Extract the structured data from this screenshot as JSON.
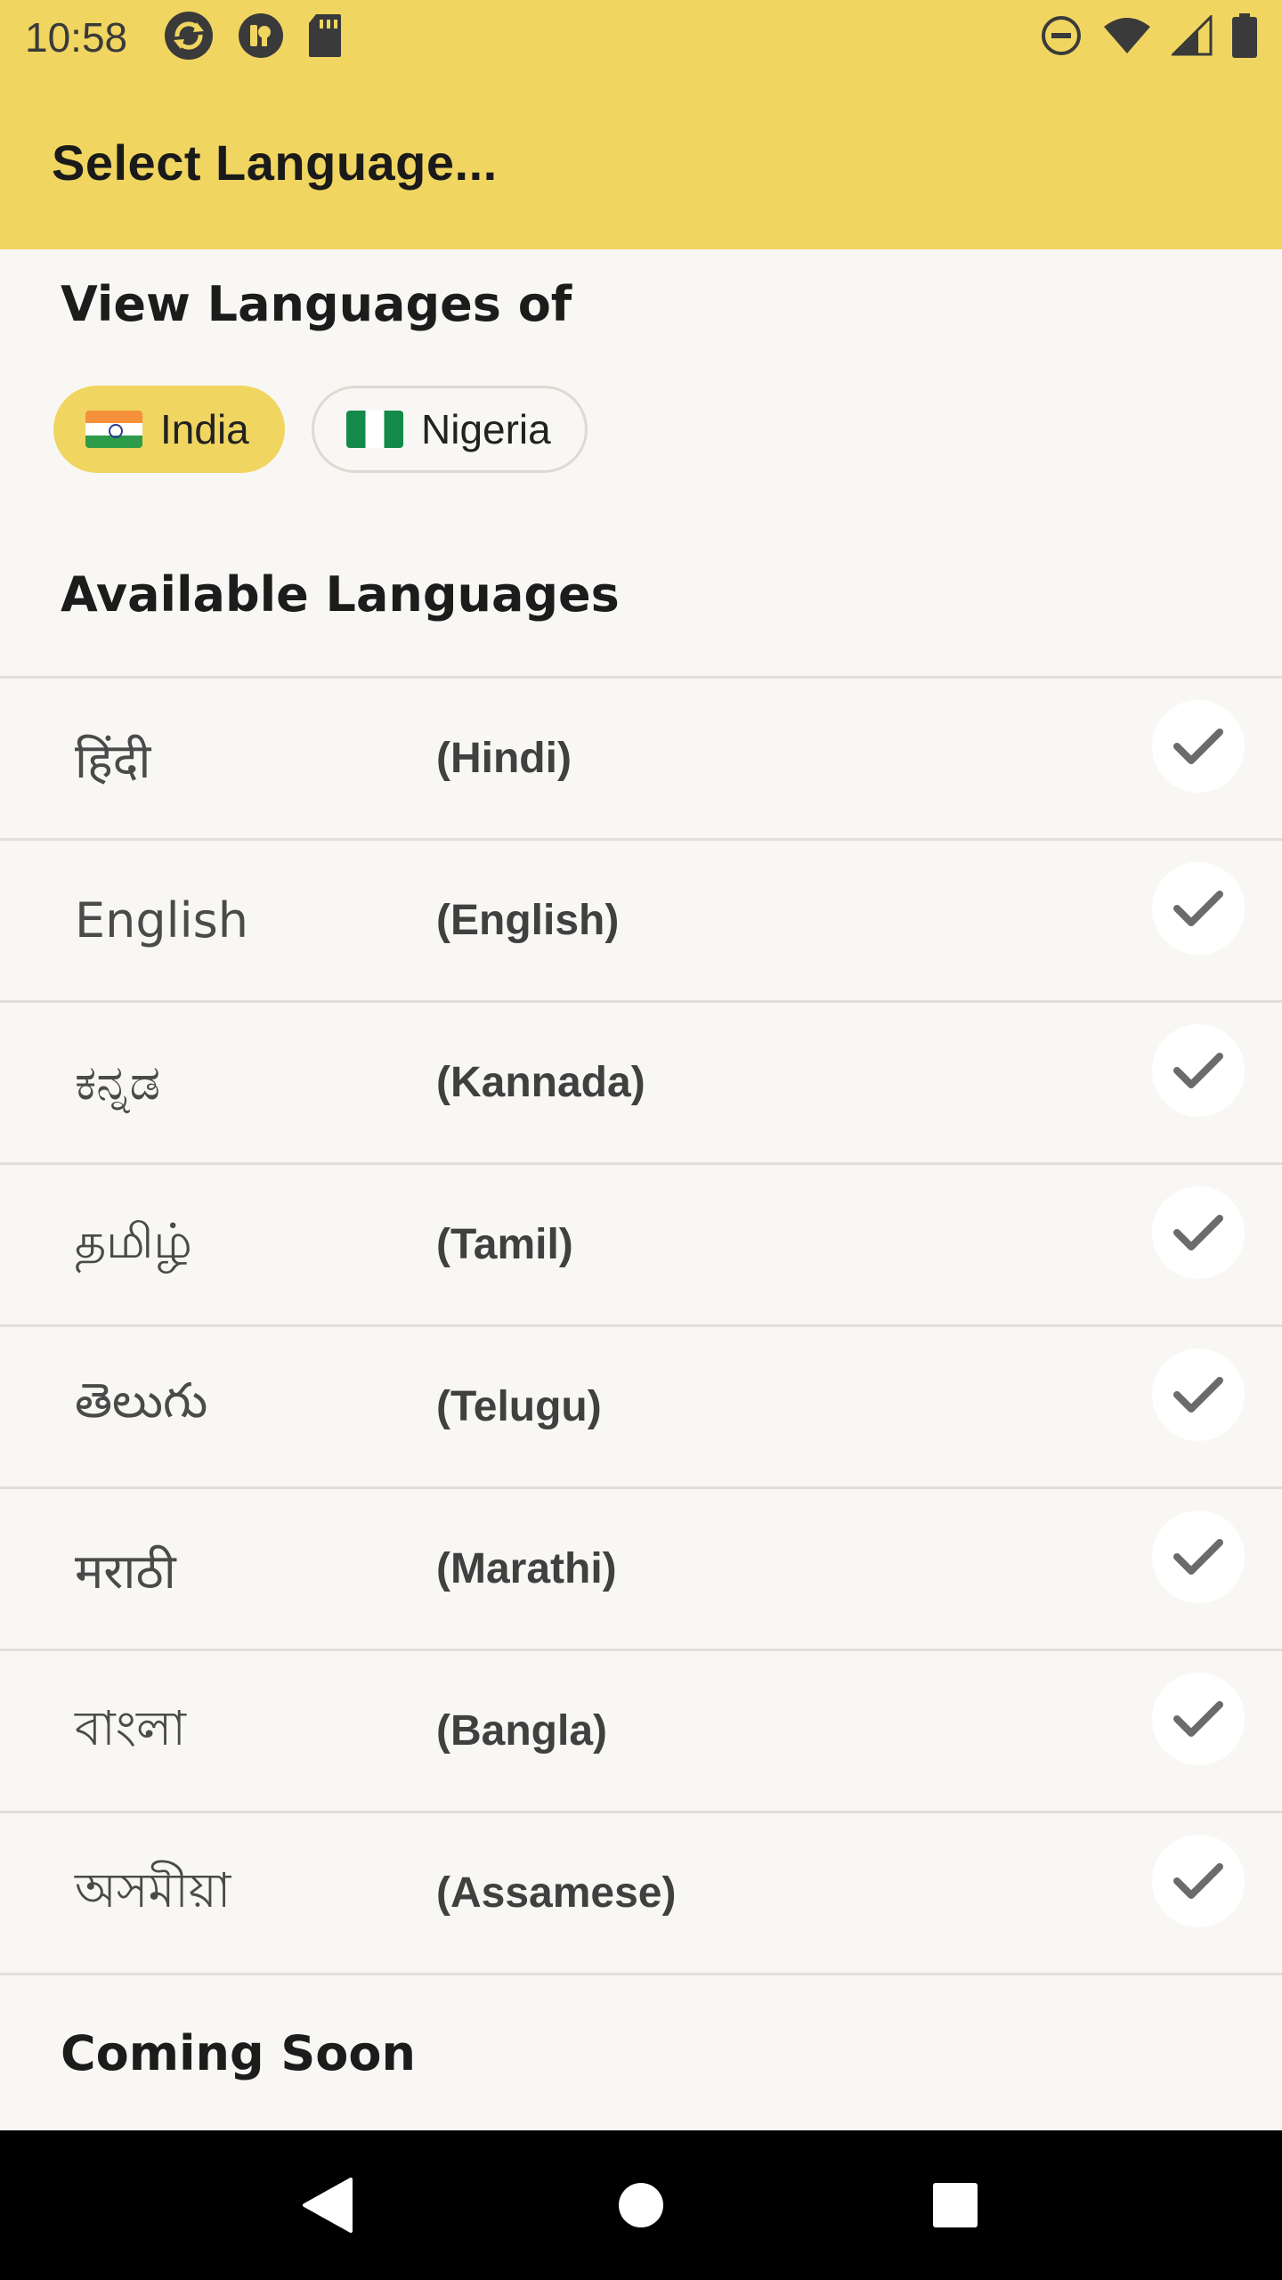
{
  "status_bar": {
    "time": "10:58",
    "left_icons": [
      "sync-icon",
      "app-badge-icon",
      "sd-card-icon"
    ],
    "right_icons": [
      "do-not-disturb-icon",
      "wifi-icon",
      "signal-icon",
      "battery-icon"
    ]
  },
  "app_bar": {
    "title": "Select Language..."
  },
  "country_section": {
    "heading": "View Languages of",
    "chips": [
      {
        "label": "India",
        "flag": "india-flag",
        "selected": true
      },
      {
        "label": "Nigeria",
        "flag": "nigeria-flag",
        "selected": false
      }
    ]
  },
  "available_section": {
    "heading": "Available Languages",
    "languages": [
      {
        "native": "हिंदी",
        "english": "(Hindi)"
      },
      {
        "native": "English",
        "english": "(English)"
      },
      {
        "native": "ಕನ್ನಡ",
        "english": "(Kannada)"
      },
      {
        "native": "தமிழ்",
        "english": "(Tamil)"
      },
      {
        "native": "తెలుగు",
        "english": "(Telugu)"
      },
      {
        "native": "मराठी",
        "english": "(Marathi)"
      },
      {
        "native": "বাংলা",
        "english": "(Bangla)"
      },
      {
        "native": "অসমীয়া",
        "english": "(Assamese)"
      }
    ]
  },
  "coming_soon_section": {
    "heading": "Coming Soon"
  },
  "nav_bar": {
    "buttons": [
      "back-icon",
      "home-icon",
      "recents-icon"
    ]
  },
  "colors": {
    "accent": "#f0d561",
    "background": "#f8f7f4",
    "divider": "#e2dfda",
    "check": "#6b6b6b"
  }
}
